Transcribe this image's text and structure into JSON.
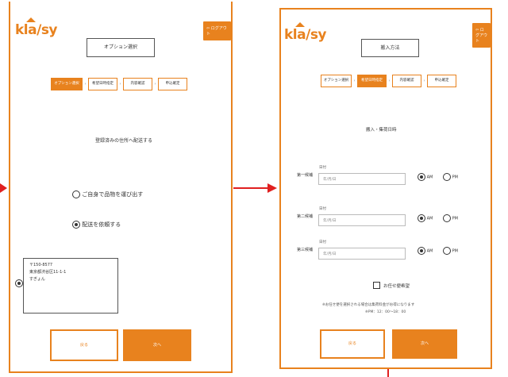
{
  "left": {
    "logo": "kla/sy",
    "logout": "ログアウト",
    "title": "オプション選択",
    "steps": [
      "オプション選択",
      "希望日時指定",
      "内容確認",
      "申込確定"
    ],
    "heading": "登録済みの住所へ配送する",
    "options": [
      "ご自身で品物を運び出す",
      "配送を依頼する"
    ],
    "address": [
      "〒150-8577",
      "東京都渋谷区11-1-1",
      "すぎょん"
    ],
    "back": "戻る",
    "next": "次へ"
  },
  "right": {
    "logo": "kla/sy",
    "logout": "ログアウト",
    "title": "搬入方法",
    "steps": [
      "オプション選択",
      "希望日時指定",
      "内容確認",
      "申込確定"
    ],
    "heading": "搬入・集荷日時",
    "rows": [
      {
        "label": "第一候補",
        "field_label": "日付",
        "placeholder": "年/月/日"
      },
      {
        "label": "第二候補",
        "field_label": "日付",
        "placeholder": "年/月/日"
      },
      {
        "label": "第三候補",
        "field_label": "日付",
        "placeholder": "年/月/日"
      }
    ],
    "am": "AM",
    "pm": "PM",
    "omakase": "お任せ便希望",
    "note1": "※お任せ便を選択される場合は集荷料金がお得になります",
    "note2": "※PM：12：00～18：00",
    "back": "戻る",
    "next": "次へ"
  },
  "colors": {
    "accent": "#e8821e",
    "arrow": "#e02020"
  }
}
